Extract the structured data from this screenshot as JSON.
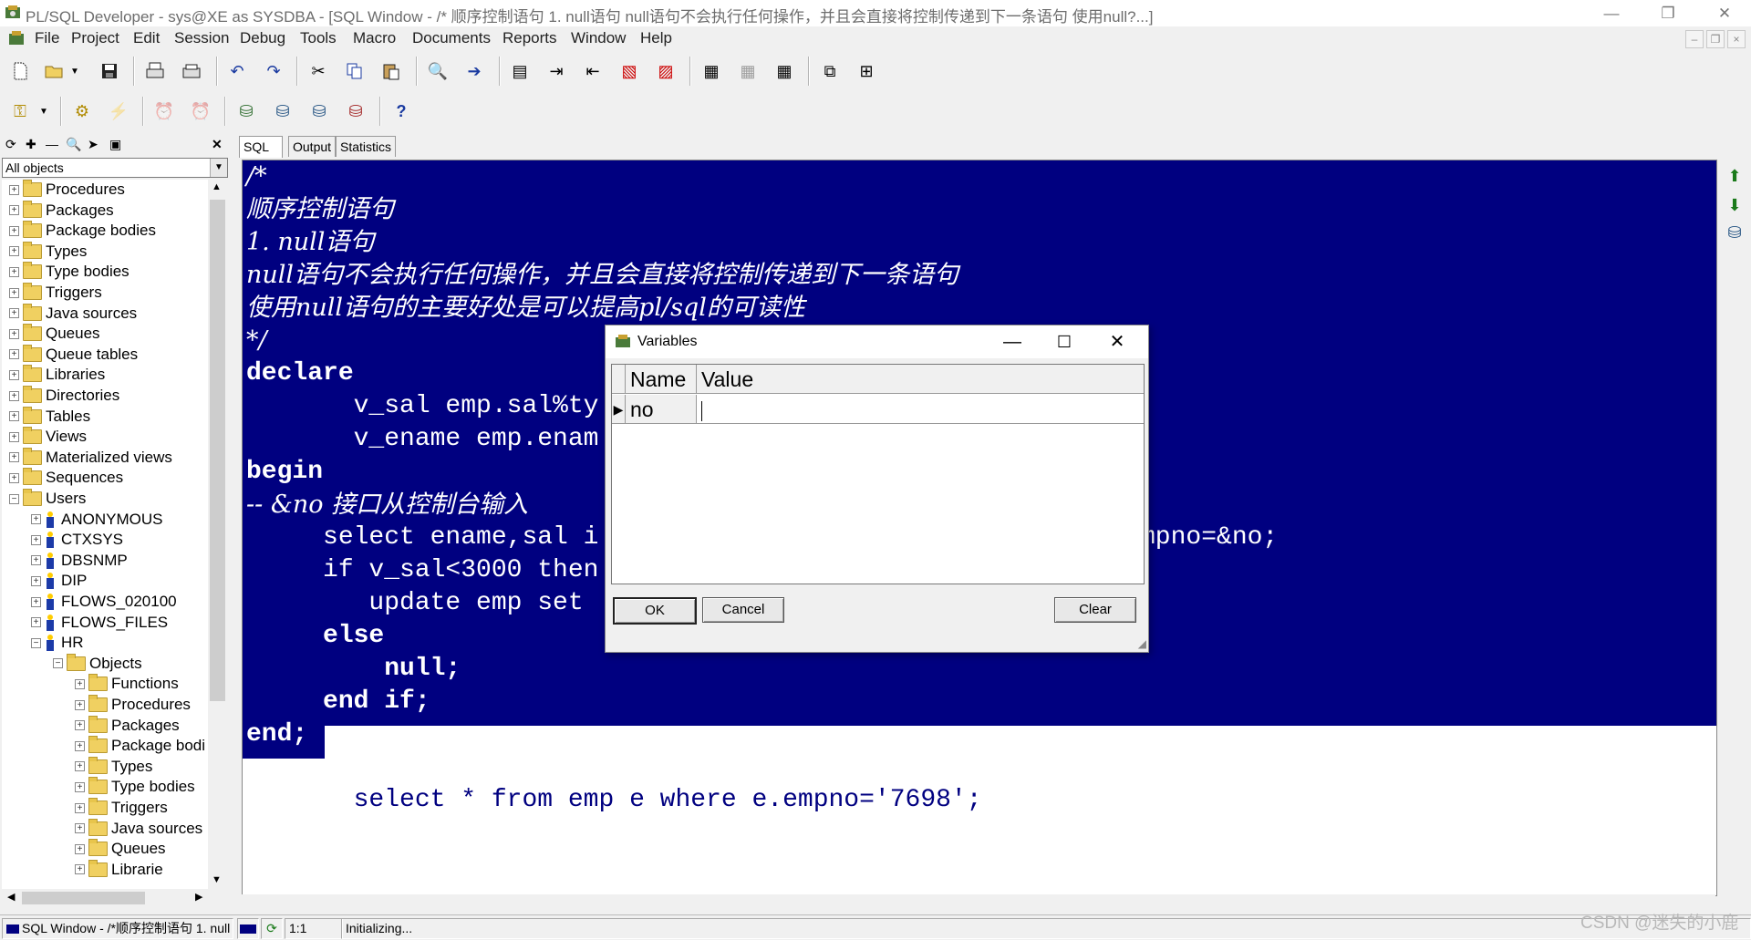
{
  "window": {
    "title": "PL/SQL Developer - sys@XE as SYSDBA - [SQL Window - /* 顺序控制语句 1. null语句 null语句不会执行任何操作，并且会直接将控制传递到下一条语句 使用null?...]"
  },
  "menu": [
    "File",
    "Project",
    "Edit",
    "Session",
    "Debug",
    "Tools",
    "Macro",
    "Documents",
    "Reports",
    "Window",
    "Help"
  ],
  "browser": {
    "filter": "All objects",
    "tree": [
      "Procedures",
      "Packages",
      "Package bodies",
      "Types",
      "Type bodies",
      "Triggers",
      "Java sources",
      "Queues",
      "Queue tables",
      "Libraries",
      "Directories",
      "Tables",
      "Views",
      "Materialized views",
      "Sequences",
      "Users",
      "ANONYMOUS",
      "CTXSYS",
      "DBSNMP",
      "DIP",
      "FLOWS_020100",
      "FLOWS_FILES",
      "HR",
      "Objects",
      "Functions",
      "Procedures",
      "Packages",
      "Package bodi",
      "Types",
      "Type bodies",
      "Triggers",
      "Java sources",
      "Queues",
      "Librarie"
    ]
  },
  "tabs": [
    "SQL",
    "Output",
    "Statistics"
  ],
  "editor": {
    "lines": [
      "/*",
      "顺序控制语句",
      "1. null语句",
      "null语句不会执行任何操作，并且会直接将控制传递到下一条语句",
      "使用null语句的主要好处是可以提高pl/sql的可读性",
      "*/",
      "declare",
      "       v_sal emp.sal%ty",
      "       v_ename emp.enam",
      "begin",
      "-- &no 接口从控制台输入",
      "     select ename,sal i",
      "     if v_sal<3000 then",
      "        update emp set",
      "     else",
      "         null;",
      "     end if;",
      "end;",
      "",
      "       select * from emp e where e.empno='7698';"
    ],
    "overflow_text": "mpno=&no;"
  },
  "dialog": {
    "title": "Variables",
    "columns": [
      "Name",
      "Value"
    ],
    "rows": [
      {
        "name": "no",
        "value": ""
      }
    ],
    "ok": "OK",
    "cancel": "Cancel",
    "clear": "Clear"
  },
  "status": {
    "window_tab": "SQL Window - /*顺序控制语句 1. null",
    "position": "1:1",
    "message": "Initializing..."
  },
  "watermark": "CSDN @迷失的小鹿",
  "colors": {
    "selection": "#000080",
    "editor_bg": "#ffffff"
  }
}
